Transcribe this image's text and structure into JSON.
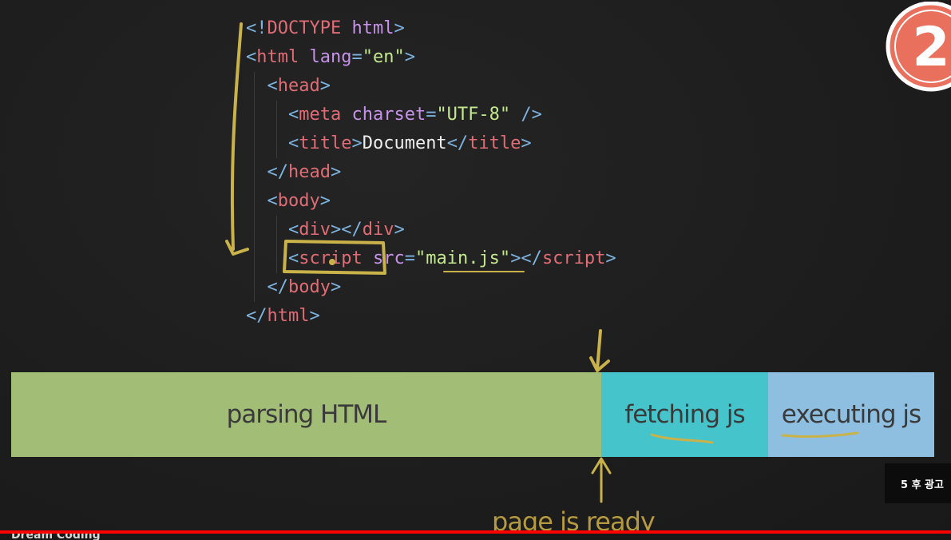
{
  "code_lines": [
    {
      "parts": [
        {
          "c": "punc",
          "t": "<!"
        },
        {
          "c": "tag",
          "t": "DOCTYPE"
        },
        {
          "c": "text",
          "t": " "
        },
        {
          "c": "attr",
          "t": "html"
        },
        {
          "c": "punc",
          "t": ">"
        }
      ]
    },
    {
      "parts": [
        {
          "c": "punc",
          "t": "<"
        },
        {
          "c": "tag",
          "t": "html"
        },
        {
          "c": "text",
          "t": " "
        },
        {
          "c": "attr",
          "t": "lang"
        },
        {
          "c": "punc",
          "t": "="
        },
        {
          "c": "str",
          "t": "\"en\""
        },
        {
          "c": "punc",
          "t": ">"
        }
      ]
    },
    {
      "parts": [
        {
          "c": "text",
          "t": "  "
        },
        {
          "c": "punc",
          "t": "<"
        },
        {
          "c": "tag",
          "t": "head"
        },
        {
          "c": "punc",
          "t": ">"
        }
      ]
    },
    {
      "parts": [
        {
          "c": "text",
          "t": "    "
        },
        {
          "c": "punc",
          "t": "<"
        },
        {
          "c": "tag",
          "t": "meta"
        },
        {
          "c": "text",
          "t": " "
        },
        {
          "c": "attr",
          "t": "charset"
        },
        {
          "c": "punc",
          "t": "="
        },
        {
          "c": "str",
          "t": "\"UTF-8\""
        },
        {
          "c": "text",
          "t": " "
        },
        {
          "c": "punc",
          "t": "/>"
        }
      ]
    },
    {
      "parts": [
        {
          "c": "text",
          "t": "    "
        },
        {
          "c": "punc",
          "t": "<"
        },
        {
          "c": "tag",
          "t": "title"
        },
        {
          "c": "punc",
          "t": ">"
        },
        {
          "c": "text",
          "t": "Document"
        },
        {
          "c": "punc",
          "t": "</"
        },
        {
          "c": "tag",
          "t": "title"
        },
        {
          "c": "punc",
          "t": ">"
        }
      ]
    },
    {
      "parts": [
        {
          "c": "text",
          "t": "  "
        },
        {
          "c": "punc",
          "t": "</"
        },
        {
          "c": "tag",
          "t": "head"
        },
        {
          "c": "punc",
          "t": ">"
        }
      ]
    },
    {
      "parts": [
        {
          "c": "text",
          "t": "  "
        },
        {
          "c": "punc",
          "t": "<"
        },
        {
          "c": "tag",
          "t": "body"
        },
        {
          "c": "punc",
          "t": ">"
        }
      ]
    },
    {
      "parts": [
        {
          "c": "text",
          "t": "    "
        },
        {
          "c": "punc",
          "t": "<"
        },
        {
          "c": "tag",
          "t": "div"
        },
        {
          "c": "punc",
          "t": "></"
        },
        {
          "c": "tag",
          "t": "div"
        },
        {
          "c": "punc",
          "t": ">"
        }
      ]
    },
    {
      "parts": [
        {
          "c": "text",
          "t": "    "
        },
        {
          "c": "punc",
          "t": "<"
        },
        {
          "c": "tag",
          "t": "script"
        },
        {
          "c": "text",
          "t": " "
        },
        {
          "c": "attr",
          "t": "src"
        },
        {
          "c": "punc",
          "t": "="
        },
        {
          "c": "str",
          "t": "\"main.js\""
        },
        {
          "c": "punc",
          "t": "></"
        },
        {
          "c": "tag",
          "t": "script"
        },
        {
          "c": "punc",
          "t": ">"
        }
      ]
    },
    {
      "parts": [
        {
          "c": "text",
          "t": "  "
        },
        {
          "c": "punc",
          "t": "</"
        },
        {
          "c": "tag",
          "t": "body"
        },
        {
          "c": "punc",
          "t": ">"
        }
      ]
    },
    {
      "parts": [
        {
          "c": "punc",
          "t": "</"
        },
        {
          "c": "tag",
          "t": "html"
        },
        {
          "c": "punc",
          "t": ">"
        }
      ]
    }
  ],
  "timeline": {
    "parsing_label": "parsing HTML",
    "fetching_label": "fetching js",
    "executing_label": "executing js",
    "parsing_color": "#a1bd76",
    "fetching_color": "#45c4cc",
    "executing_color": "#8fbfe0"
  },
  "annotation": {
    "ready_label": "page is ready",
    "pen_color": "#c9b24a"
  },
  "badge": {
    "number": "2",
    "color": "#e8705c"
  },
  "ad": {
    "countdown_text": "5 후 광고"
  },
  "player": {
    "progress": 1.0,
    "progress_color": "#ff0000",
    "channel_name": "Dream Coding"
  }
}
